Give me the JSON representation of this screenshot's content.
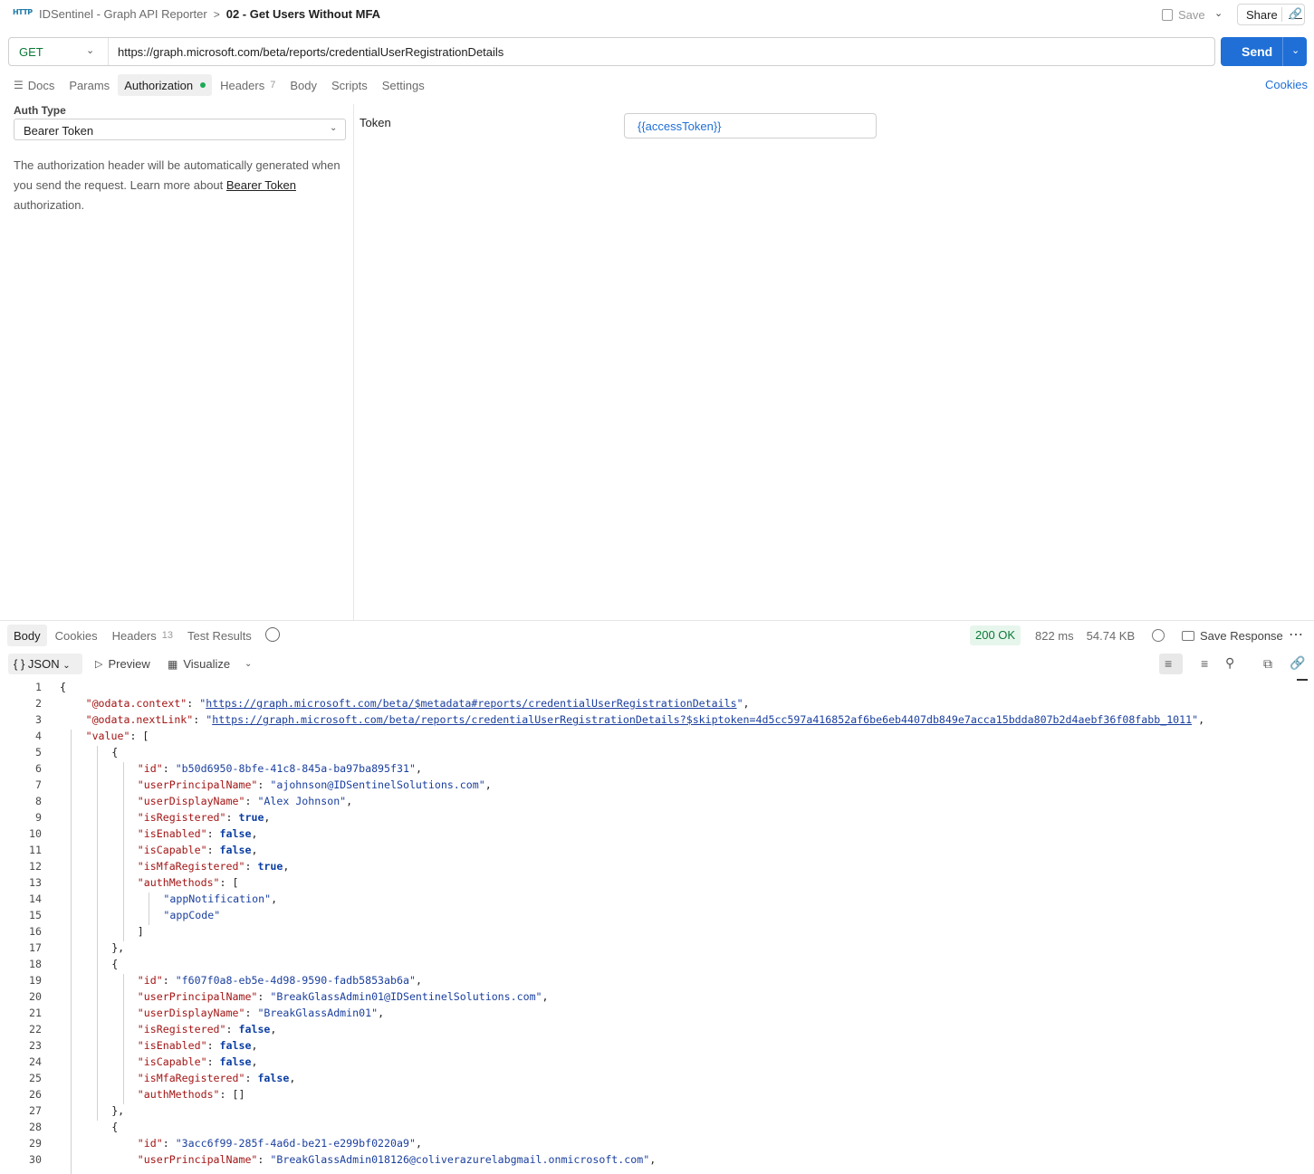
{
  "breadcrumb": {
    "icon_label": "HTTP",
    "parent": "IDSentinel - Graph API Reporter",
    "separator": ">",
    "current": "02 - Get Users Without MFA"
  },
  "header": {
    "save_label": "Save",
    "share_label": "Share"
  },
  "request": {
    "method": "GET",
    "url": "https://graph.microsoft.com/beta/reports/credentialUserRegistrationDetails",
    "send_label": "Send"
  },
  "request_tabs": [
    {
      "label": "Docs"
    },
    {
      "label": "Params"
    },
    {
      "label": "Authorization"
    },
    {
      "label": "Headers",
      "count": "7"
    },
    {
      "label": "Body"
    },
    {
      "label": "Scripts"
    },
    {
      "label": "Settings"
    }
  ],
  "cookies_link": "Cookies",
  "auth": {
    "type_label": "Auth Type",
    "type_value": "Bearer Token",
    "help_prefix": "The authorization header will be automatically generated when you send the request. Learn more about ",
    "help_link": "Bearer Token",
    "help_suffix": " authorization.",
    "token_label": "Token",
    "token_value": "{{accessToken}}"
  },
  "response_tabs": [
    {
      "label": "Body"
    },
    {
      "label": "Cookies"
    },
    {
      "label": "Headers",
      "count": "13"
    },
    {
      "label": "Test Results"
    }
  ],
  "response_meta": {
    "status": "200 OK",
    "time": "822 ms",
    "size": "54.74 KB",
    "save_response_label": "Save Response"
  },
  "view": {
    "format": "JSON",
    "format_icon": "{ }",
    "preview_label": "Preview",
    "visualize_label": "Visualize"
  },
  "code_lines": [
    {
      "n": "1",
      "indent": 0,
      "parts": [
        [
          "p",
          "{"
        ]
      ]
    },
    {
      "n": "2",
      "indent": 1,
      "parts": [
        [
          "k",
          "\"@odata.context\""
        ],
        [
          "p",
          ": "
        ],
        [
          "s",
          "\""
        ],
        [
          "lnk",
          "https://graph.microsoft.com/beta/$metadata#reports/credentialUserRegistrationDetails"
        ],
        [
          "s",
          "\""
        ],
        [
          "p",
          ","
        ]
      ]
    },
    {
      "n": "3",
      "indent": 1,
      "parts": [
        [
          "k",
          "\"@odata.nextLink\""
        ],
        [
          "p",
          ": "
        ],
        [
          "s",
          "\""
        ],
        [
          "lnk",
          "https://graph.microsoft.com/beta/reports/credentialUserRegistrationDetails?$skiptoken=4d5cc597a416852af6be6eb4407db849e7acca15bdda807b2d4aebf36f08fabb_1011"
        ],
        [
          "s",
          "\""
        ],
        [
          "p",
          ","
        ]
      ]
    },
    {
      "n": "4",
      "indent": 1,
      "parts": [
        [
          "k",
          "\"value\""
        ],
        [
          "p",
          ": ["
        ]
      ]
    },
    {
      "n": "5",
      "indent": 2,
      "parts": [
        [
          "p",
          "{"
        ]
      ]
    },
    {
      "n": "6",
      "indent": 3,
      "parts": [
        [
          "k",
          "\"id\""
        ],
        [
          "p",
          ": "
        ],
        [
          "s",
          "\"b50d6950-8bfe-41c8-845a-ba97ba895f31\""
        ],
        [
          "p",
          ","
        ]
      ]
    },
    {
      "n": "7",
      "indent": 3,
      "parts": [
        [
          "k",
          "\"userPrincipalName\""
        ],
        [
          "p",
          ": "
        ],
        [
          "s",
          "\"ajohnson@IDSentinelSolutions.com\""
        ],
        [
          "p",
          ","
        ]
      ]
    },
    {
      "n": "8",
      "indent": 3,
      "parts": [
        [
          "k",
          "\"userDisplayName\""
        ],
        [
          "p",
          ": "
        ],
        [
          "s",
          "\"Alex Johnson\""
        ],
        [
          "p",
          ","
        ]
      ]
    },
    {
      "n": "9",
      "indent": 3,
      "parts": [
        [
          "k",
          "\"isRegistered\""
        ],
        [
          "p",
          ": "
        ],
        [
          "b",
          "true"
        ],
        [
          "p",
          ","
        ]
      ]
    },
    {
      "n": "10",
      "indent": 3,
      "parts": [
        [
          "k",
          "\"isEnabled\""
        ],
        [
          "p",
          ": "
        ],
        [
          "b",
          "false"
        ],
        [
          "p",
          ","
        ]
      ]
    },
    {
      "n": "11",
      "indent": 3,
      "parts": [
        [
          "k",
          "\"isCapable\""
        ],
        [
          "p",
          ": "
        ],
        [
          "b",
          "false"
        ],
        [
          "p",
          ","
        ]
      ]
    },
    {
      "n": "12",
      "indent": 3,
      "parts": [
        [
          "k",
          "\"isMfaRegistered\""
        ],
        [
          "p",
          ": "
        ],
        [
          "b",
          "true"
        ],
        [
          "p",
          ","
        ]
      ]
    },
    {
      "n": "13",
      "indent": 3,
      "parts": [
        [
          "k",
          "\"authMethods\""
        ],
        [
          "p",
          ": ["
        ]
      ]
    },
    {
      "n": "14",
      "indent": 4,
      "parts": [
        [
          "s",
          "\"appNotification\""
        ],
        [
          "p",
          ","
        ]
      ]
    },
    {
      "n": "15",
      "indent": 4,
      "parts": [
        [
          "s",
          "\"appCode\""
        ]
      ]
    },
    {
      "n": "16",
      "indent": 3,
      "parts": [
        [
          "p",
          "]"
        ]
      ]
    },
    {
      "n": "17",
      "indent": 2,
      "parts": [
        [
          "p",
          "},"
        ]
      ]
    },
    {
      "n": "18",
      "indent": 2,
      "parts": [
        [
          "p",
          "{"
        ]
      ]
    },
    {
      "n": "19",
      "indent": 3,
      "parts": [
        [
          "k",
          "\"id\""
        ],
        [
          "p",
          ": "
        ],
        [
          "s",
          "\"f607f0a8-eb5e-4d98-9590-fadb5853ab6a\""
        ],
        [
          "p",
          ","
        ]
      ]
    },
    {
      "n": "20",
      "indent": 3,
      "parts": [
        [
          "k",
          "\"userPrincipalName\""
        ],
        [
          "p",
          ": "
        ],
        [
          "s",
          "\"BreakGlassAdmin01@IDSentinelSolutions.com\""
        ],
        [
          "p",
          ","
        ]
      ]
    },
    {
      "n": "21",
      "indent": 3,
      "parts": [
        [
          "k",
          "\"userDisplayName\""
        ],
        [
          "p",
          ": "
        ],
        [
          "s",
          "\"BreakGlassAdmin01\""
        ],
        [
          "p",
          ","
        ]
      ]
    },
    {
      "n": "22",
      "indent": 3,
      "parts": [
        [
          "k",
          "\"isRegistered\""
        ],
        [
          "p",
          ": "
        ],
        [
          "b",
          "false"
        ],
        [
          "p",
          ","
        ]
      ]
    },
    {
      "n": "23",
      "indent": 3,
      "parts": [
        [
          "k",
          "\"isEnabled\""
        ],
        [
          "p",
          ": "
        ],
        [
          "b",
          "false"
        ],
        [
          "p",
          ","
        ]
      ]
    },
    {
      "n": "24",
      "indent": 3,
      "parts": [
        [
          "k",
          "\"isCapable\""
        ],
        [
          "p",
          ": "
        ],
        [
          "b",
          "false"
        ],
        [
          "p",
          ","
        ]
      ]
    },
    {
      "n": "25",
      "indent": 3,
      "parts": [
        [
          "k",
          "\"isMfaRegistered\""
        ],
        [
          "p",
          ": "
        ],
        [
          "b",
          "false"
        ],
        [
          "p",
          ","
        ]
      ]
    },
    {
      "n": "26",
      "indent": 3,
      "parts": [
        [
          "k",
          "\"authMethods\""
        ],
        [
          "p",
          ": []"
        ]
      ]
    },
    {
      "n": "27",
      "indent": 2,
      "parts": [
        [
          "p",
          "},"
        ]
      ]
    },
    {
      "n": "28",
      "indent": 2,
      "parts": [
        [
          "p",
          "{"
        ]
      ]
    },
    {
      "n": "29",
      "indent": 3,
      "parts": [
        [
          "k",
          "\"id\""
        ],
        [
          "p",
          ": "
        ],
        [
          "s",
          "\"3acc6f99-285f-4a6d-be21-e299bf0220a9\""
        ],
        [
          "p",
          ","
        ]
      ]
    },
    {
      "n": "30",
      "indent": 3,
      "parts": [
        [
          "k",
          "\"userPrincipalName\""
        ],
        [
          "p",
          ": "
        ],
        [
          "s",
          "\"BreakGlassAdmin018126@coliverazurelabgmail.onmicrosoft.com\""
        ],
        [
          "p",
          ","
        ]
      ]
    }
  ]
}
